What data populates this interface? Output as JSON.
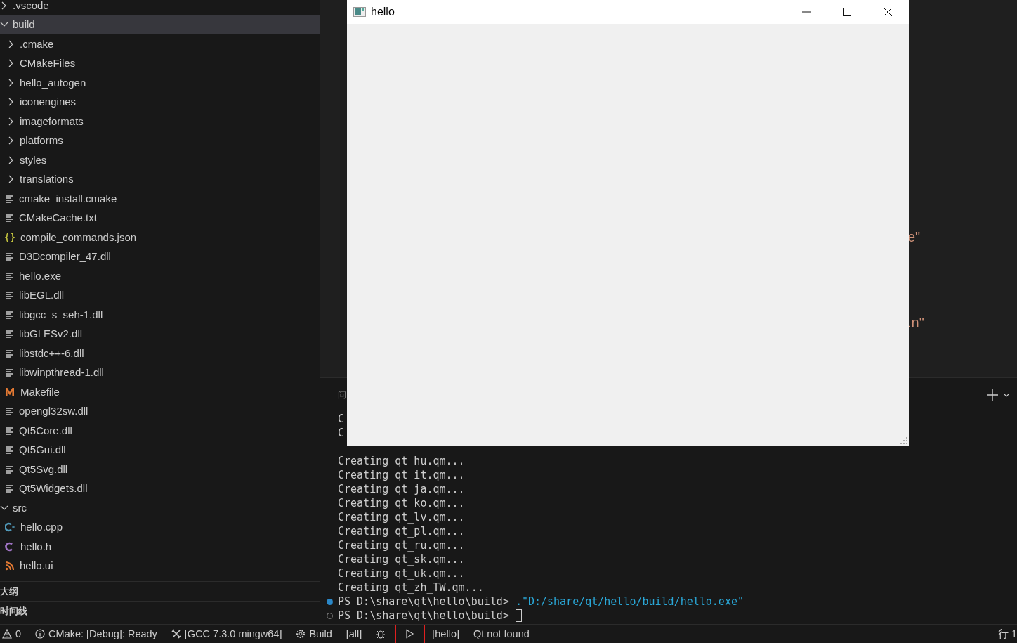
{
  "explorer": {
    "items": [
      {
        "label": ".vscode",
        "kind": "folder",
        "expanded": false,
        "selected": false
      },
      {
        "label": "build",
        "kind": "folder",
        "expanded": true,
        "selected": true,
        "children": [
          {
            "label": ".cmake",
            "kind": "folder",
            "expanded": false,
            "selected": false
          },
          {
            "label": "CMakeFiles",
            "kind": "folder",
            "expanded": false,
            "selected": false
          },
          {
            "label": "hello_autogen",
            "kind": "folder",
            "expanded": false,
            "selected": false
          },
          {
            "label": "iconengines",
            "kind": "folder",
            "expanded": false,
            "selected": false
          },
          {
            "label": "imageformats",
            "kind": "folder",
            "expanded": false,
            "selected": false
          },
          {
            "label": "platforms",
            "kind": "folder",
            "expanded": false,
            "selected": false
          },
          {
            "label": "styles",
            "kind": "folder",
            "expanded": false,
            "selected": false
          },
          {
            "label": "translations",
            "kind": "folder",
            "expanded": false,
            "selected": false
          },
          {
            "label": "cmake_install.cmake",
            "kind": "text",
            "selected": false
          },
          {
            "label": "CMakeCache.txt",
            "kind": "text",
            "selected": false
          },
          {
            "label": "compile_commands.json",
            "kind": "json",
            "selected": false
          },
          {
            "label": "D3Dcompiler_47.dll",
            "kind": "text",
            "selected": false
          },
          {
            "label": "hello.exe",
            "kind": "text",
            "selected": false
          },
          {
            "label": "libEGL.dll",
            "kind": "text",
            "selected": false
          },
          {
            "label": "libgcc_s_seh-1.dll",
            "kind": "text",
            "selected": false
          },
          {
            "label": "libGLESv2.dll",
            "kind": "text",
            "selected": false
          },
          {
            "label": "libstdc++-6.dll",
            "kind": "text",
            "selected": false
          },
          {
            "label": "libwinpthread-1.dll",
            "kind": "text",
            "selected": false
          },
          {
            "label": "Makefile",
            "kind": "makefile",
            "selected": false
          },
          {
            "label": "opengl32sw.dll",
            "kind": "text",
            "selected": false
          },
          {
            "label": "Qt5Core.dll",
            "kind": "text",
            "selected": false
          },
          {
            "label": "Qt5Gui.dll",
            "kind": "text",
            "selected": false
          },
          {
            "label": "Qt5Svg.dll",
            "kind": "text",
            "selected": false
          },
          {
            "label": "Qt5Widgets.dll",
            "kind": "text",
            "selected": false
          }
        ]
      },
      {
        "label": "src",
        "kind": "folder",
        "expanded": true,
        "selected": false,
        "children": [
          {
            "label": "hello.cpp",
            "kind": "cpp",
            "selected": false
          },
          {
            "label": "hello.h",
            "kind": "header",
            "selected": false
          },
          {
            "label": "hello.ui",
            "kind": "ui",
            "selected": false
          }
        ]
      }
    ]
  },
  "sections": [
    "大纲",
    "时间线"
  ],
  "editor": {
    "fragments": [
      "e\"",
      ".n\""
    ]
  },
  "panel": {
    "tab": "问",
    "lines": [
      {
        "text": "C",
        "kind": "clipped"
      },
      {
        "text": "C",
        "kind": "clipped"
      },
      {
        "text": "Creating qt_hu.qm...",
        "kind": "output"
      },
      {
        "text": "Creating qt_it.qm...",
        "kind": "output"
      },
      {
        "text": "Creating qt_ja.qm...",
        "kind": "output"
      },
      {
        "text": "Creating qt_ko.qm...",
        "kind": "output"
      },
      {
        "text": "Creating qt_lv.qm...",
        "kind": "output"
      },
      {
        "text": "Creating qt_pl.qm...",
        "kind": "output"
      },
      {
        "text": "Creating qt_ru.qm...",
        "kind": "output"
      },
      {
        "text": "Creating qt_sk.qm...",
        "kind": "output"
      },
      {
        "text": "Creating qt_uk.qm...",
        "kind": "output"
      },
      {
        "text": "Creating qt_zh_TW.qm...",
        "kind": "output"
      },
      {
        "text": "PS D:\\share\\qt\\hello\\build> ",
        "arg": ".\"D:/share/qt/hello/build/hello.exe\"",
        "kind": "prompt",
        "active": true
      },
      {
        "text": "PS D:\\share\\qt\\hello\\build> ",
        "kind": "prompt",
        "active": false,
        "cursor": true
      }
    ]
  },
  "app_window": {
    "title": "hello"
  },
  "status_bar": [
    {
      "kind": "problems",
      "text": "0"
    },
    {
      "kind": "info",
      "text": "CMake: [Debug]: Ready"
    },
    {
      "kind": "kit",
      "text": "[GCC 7.3.0 mingw64]"
    },
    {
      "kind": "build",
      "text": "Build"
    },
    {
      "kind": "plain",
      "text": "[all]"
    },
    {
      "kind": "debug"
    },
    {
      "kind": "run",
      "highlighted": true
    },
    {
      "kind": "plain",
      "text": "[hello]"
    },
    {
      "kind": "plain",
      "text": "Qt not found"
    },
    {
      "kind": "right",
      "text": "行 1"
    }
  ]
}
